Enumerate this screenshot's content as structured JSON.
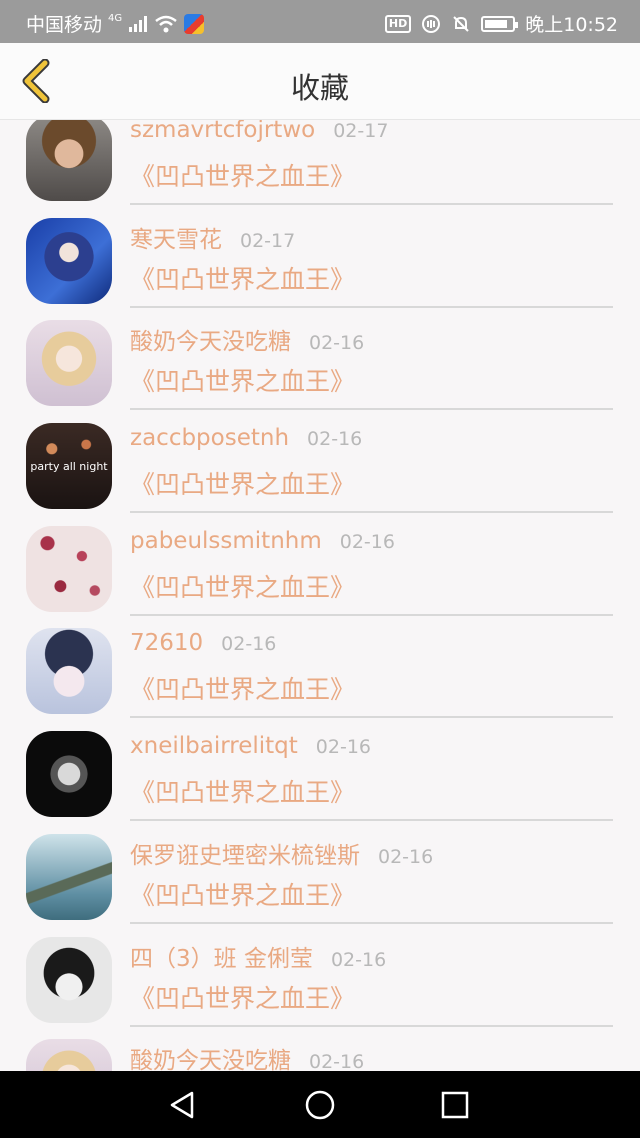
{
  "status_bar": {
    "carrier": "中国移动",
    "network": "4G",
    "time": "晚上10:52",
    "hd": "HD"
  },
  "header": {
    "title": "收藏",
    "back_icon": "chevron-left-icon"
  },
  "items": [
    {
      "name": "szmavrtcfojrtwo",
      "date": "02-17",
      "book": "《凹凸世界之血王》"
    },
    {
      "name": "寒天雪花",
      "date": "02-17",
      "book": "《凹凸世界之血王》"
    },
    {
      "name": "酸奶今天没吃糖",
      "date": "02-16",
      "book": "《凹凸世界之血王》"
    },
    {
      "name": "zaccbposetnh",
      "date": "02-16",
      "book": "《凹凸世界之血王》"
    },
    {
      "name": "pabeulssmitnhm",
      "date": "02-16",
      "book": "《凹凸世界之血王》"
    },
    {
      "name": "72610",
      "date": "02-16",
      "book": "《凹凸世界之血王》"
    },
    {
      "name": "xneilbairrelitqt",
      "date": "02-16",
      "book": "《凹凸世界之血王》"
    },
    {
      "name": "保罗诳史堙密米梳锉斯",
      "date": "02-16",
      "book": "《凹凸世界之血王》"
    },
    {
      "name": "四（3）班 金俐莹",
      "date": "02-16",
      "book": "《凹凸世界之血王》"
    },
    {
      "name": "酸奶今天没吃糖",
      "date": "02-16",
      "book": ""
    }
  ],
  "avatar_overlay_text": "party all night",
  "colors": {
    "accent": "#e9a983",
    "back_icon": "#f0c43a",
    "date": "#b8b8b8"
  }
}
